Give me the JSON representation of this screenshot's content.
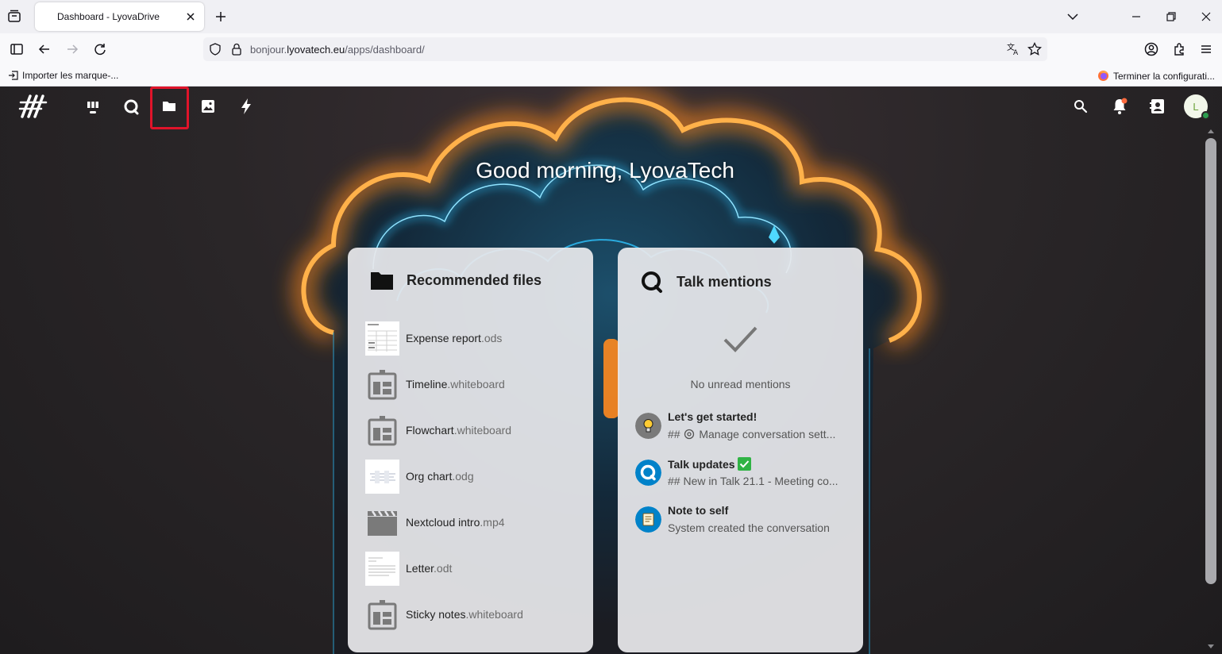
{
  "browser": {
    "tab_title": "Dashboard - LyovaDrive",
    "url_domain_prefix": "bonjour.",
    "url_domain_main": "lyovatech.eu",
    "url_path": "/apps/dashboard/",
    "bookmark_import": "Importer les marque-...",
    "bookmark_finish": "Terminer la configurati..."
  },
  "app": {
    "avatar_letter": "L",
    "greeting": "Good morning, LyovaTech"
  },
  "files_widget": {
    "title": "Recommended files",
    "items": [
      {
        "name": "Expense report",
        "ext": ".ods"
      },
      {
        "name": "Timeline",
        "ext": ".whiteboard"
      },
      {
        "name": "Flowchart",
        "ext": ".whiteboard"
      },
      {
        "name": "Org chart",
        "ext": ".odg"
      },
      {
        "name": "Nextcloud intro",
        "ext": ".mp4"
      },
      {
        "name": "Letter",
        "ext": ".odt"
      },
      {
        "name": "Sticky notes",
        "ext": ".whiteboard"
      }
    ]
  },
  "talk_widget": {
    "title": "Talk mentions",
    "empty_text": "No unread mentions",
    "conversations": [
      {
        "title": "Let's get started!",
        "sub_prefix": "## ",
        "sub_text": " Manage conversation sett..."
      },
      {
        "title": "Talk updates",
        "sub": "## New in Talk 21.1 - Meeting co..."
      },
      {
        "title": "Note to self",
        "sub": "System created the conversation"
      }
    ]
  },
  "colors": {
    "highlight": "#e0142a",
    "talk_blue": "#0082c9",
    "check_green": "#2fb344"
  }
}
